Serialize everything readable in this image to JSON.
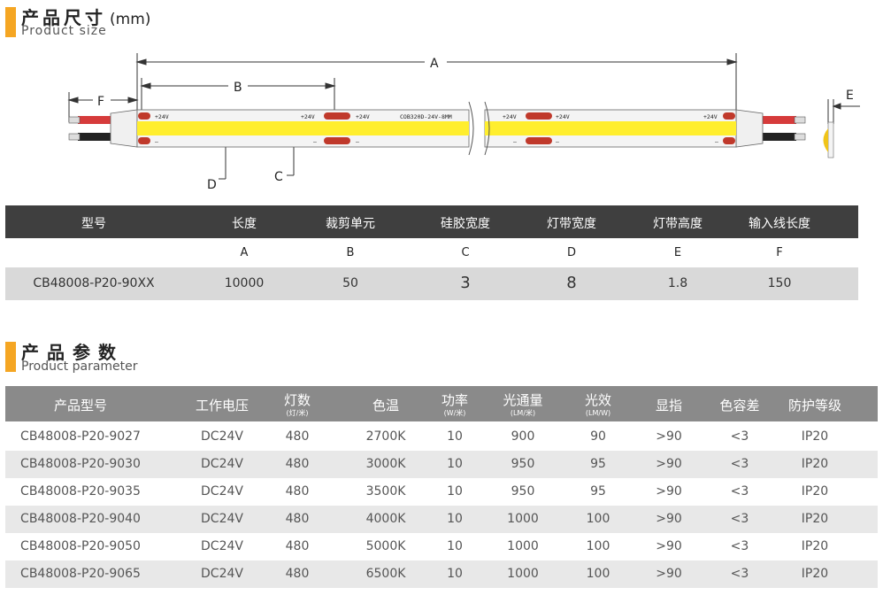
{
  "size_section": {
    "title_zh": "产品尺寸",
    "unit": "(mm)",
    "title_en": "Product size"
  },
  "diagram": {
    "dim_a": "A",
    "dim_b": "B",
    "dim_c": "C",
    "dim_d": "D",
    "dim_e": "E",
    "dim_f": "F",
    "plus_label": "+24V",
    "minus_label": "–",
    "model_print": "COB320D-24V-8MM",
    "colors": {
      "strip": "#ffee2e",
      "pad": "#c0392b",
      "wire_red": "#d63b3b",
      "wire_black": "#222222"
    }
  },
  "spec_table": {
    "headers": [
      "型号",
      "长度",
      "裁剪单元",
      "硅胶宽度",
      "灯带宽度",
      "灯带高度",
      "输入线长度"
    ],
    "letters": [
      "",
      "A",
      "B",
      "C",
      "D",
      "E",
      "F"
    ],
    "values": [
      "CB48008-P20-90XX",
      "10000",
      "50",
      "3",
      "8",
      "1.8",
      "150"
    ]
  },
  "param_section": {
    "title_zh": "产品参数",
    "title_en": "Product parameter"
  },
  "param_table": {
    "headers": [
      {
        "label": "产品型号",
        "sub": ""
      },
      {
        "label": "工作电压",
        "sub": ""
      },
      {
        "label": "灯数",
        "sub": "(灯/米)"
      },
      {
        "label": "色温",
        "sub": ""
      },
      {
        "label": "功率",
        "sub": "(W/米)"
      },
      {
        "label": "光通量",
        "sub": "(LM/米)"
      },
      {
        "label": "光效",
        "sub": "(LM/W)"
      },
      {
        "label": "显指",
        "sub": ""
      },
      {
        "label": "色容差",
        "sub": ""
      },
      {
        "label": "防护等级",
        "sub": ""
      }
    ],
    "rows": [
      [
        "CB48008-P20-9027",
        "DC24V",
        "480",
        "2700K",
        "10",
        "900",
        "90",
        ">90",
        "<3",
        "IP20"
      ],
      [
        "CB48008-P20-9030",
        "DC24V",
        "480",
        "3000K",
        "10",
        "950",
        "95",
        ">90",
        "<3",
        "IP20"
      ],
      [
        "CB48008-P20-9035",
        "DC24V",
        "480",
        "3500K",
        "10",
        "950",
        "95",
        ">90",
        "<3",
        "IP20"
      ],
      [
        "CB48008-P20-9040",
        "DC24V",
        "480",
        "4000K",
        "10",
        "1000",
        "100",
        ">90",
        "<3",
        "IP20"
      ],
      [
        "CB48008-P20-9050",
        "DC24V",
        "480",
        "5000K",
        "10",
        "1000",
        "100",
        ">90",
        "<3",
        "IP20"
      ],
      [
        "CB48008-P20-9065",
        "DC24V",
        "480",
        "6500K",
        "10",
        "1000",
        "100",
        ">90",
        "<3",
        "IP20"
      ]
    ]
  }
}
